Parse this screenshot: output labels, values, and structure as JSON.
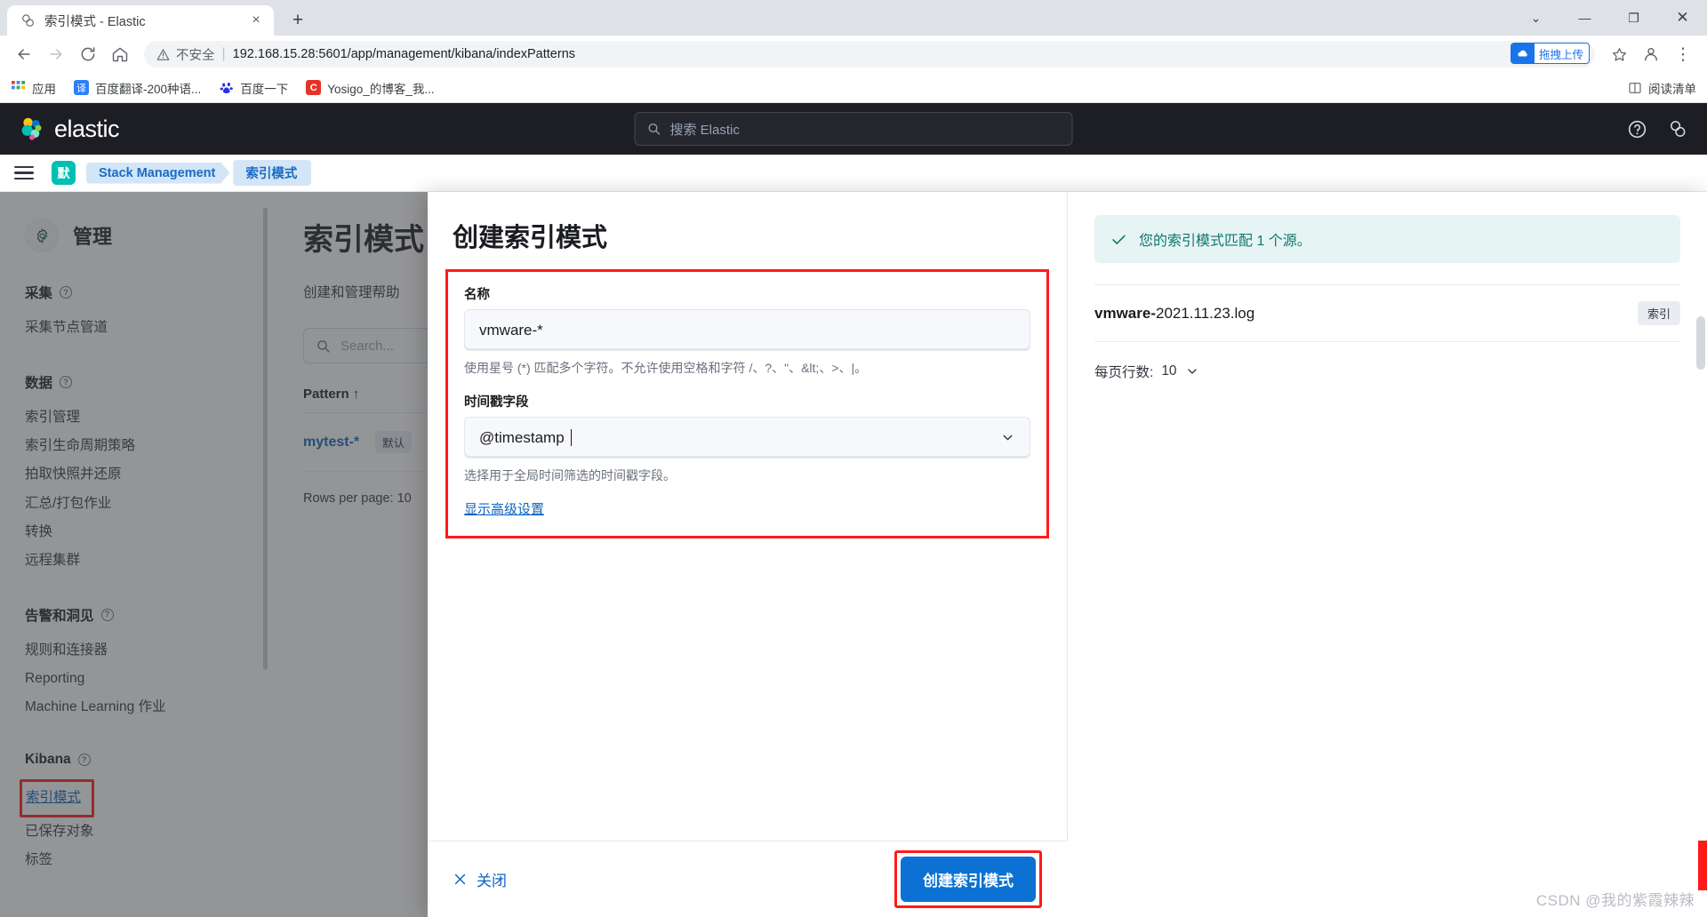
{
  "browser": {
    "tab": {
      "title": "索引模式 - Elastic",
      "favicon": "elastic-favicon",
      "close": "×"
    },
    "new_tab_label": "+",
    "window_controls": {
      "minimize_alt": "⌄",
      "minimize": "—",
      "maximize": "❐",
      "close": "✕"
    },
    "nav": {
      "back": "←",
      "forward": "→",
      "reload": "C",
      "home": "⌂"
    },
    "omnibox": {
      "security_label": "不安全",
      "separator": "|",
      "url": "192.168.15.28:5601/app/management/kibana/indexPatterns",
      "upload_chip": "拖拽上传",
      "star": "☆",
      "profile": "profile-icon",
      "menu": "⋮"
    },
    "bookmarks": [
      {
        "label": "应用",
        "icon": "apps-grid-icon",
        "color": "#ffffff"
      },
      {
        "label": "百度翻译-200种语...",
        "icon": "translate-icon",
        "color": "#2d7ff9"
      },
      {
        "label": "百度一下",
        "icon": "baidu-paw-icon",
        "color": "#ffffff"
      },
      {
        "label": "Yosigo_的博客_我...",
        "icon": "csdn-icon",
        "color": "#e63329"
      }
    ],
    "bookmarks_right": {
      "label": "阅读清单",
      "icon": "reading-list-icon"
    }
  },
  "elastic_header": {
    "brand": "elastic",
    "search_placeholder": "搜索 Elastic",
    "search_icon": "search-icon",
    "right_icons": [
      "help-icon",
      "news-icon"
    ]
  },
  "breadcrumb_bar": {
    "menu_icon": "hamburger-menu-icon",
    "space_badge": "默",
    "items": [
      {
        "label": "Stack Management"
      },
      {
        "label": "索引模式"
      }
    ]
  },
  "sidebar": {
    "title": "管理",
    "title_icon": "gear-icon",
    "groups": [
      {
        "heading": "采集",
        "has_help": true,
        "items": [
          {
            "label": "采集节点管道"
          }
        ]
      },
      {
        "heading": "数据",
        "has_help": true,
        "items": [
          {
            "label": "索引管理"
          },
          {
            "label": "索引生命周期策略"
          },
          {
            "label": "拍取快照并还原"
          },
          {
            "label": "汇总/打包作业"
          },
          {
            "label": "转换"
          },
          {
            "label": "远程集群"
          }
        ]
      },
      {
        "heading": "告警和洞见",
        "has_help": true,
        "items": [
          {
            "label": "规则和连接器"
          },
          {
            "label": "Reporting"
          },
          {
            "label": "Machine Learning 作业"
          }
        ]
      },
      {
        "heading": "Kibana",
        "has_help": true,
        "items": [
          {
            "label": "索引模式",
            "highlighted": true
          },
          {
            "label": "已保存对象"
          },
          {
            "label": "标签"
          }
        ]
      }
    ]
  },
  "main": {
    "title": "索引模式",
    "subtitle": "创建和管理帮助",
    "search_placeholder": "Search...",
    "search_icon": "search-icon",
    "table_header": "Pattern",
    "sort_icon": "↑",
    "rows": [
      {
        "name": "mytest-*",
        "badge": "默认"
      }
    ],
    "rows_per_page": "Rows per page: 10"
  },
  "flyout": {
    "heading": "创建索引模式",
    "name_field": {
      "label": "名称",
      "value": "vmware-*",
      "help": "使用星号 (*) 匹配多个字符。不允许使用空格和字符 /、?、\"、&lt;、>、|。"
    },
    "timestamp_field": {
      "label": "时间戳字段",
      "value": "@timestamp",
      "help": "选择用于全局时间筛选的时间戳字段。",
      "caret_icon": "chevron-down-icon"
    },
    "advanced_link": "显示高级设置",
    "footer": {
      "close_label": "关闭",
      "close_icon": "close-x-icon",
      "submit_label": "创建索引模式"
    },
    "right_panel": {
      "callout": "您的索引模式匹配 1 个源。",
      "callout_icon": "check-icon",
      "matches": [
        {
          "bold": "vmware-",
          "rest": "2021.11.23.log",
          "badge": "索引"
        }
      ],
      "rows_per_page_label": "每页行数:",
      "rows_per_page_value": "10",
      "rows_per_page_caret": "chevron-down-icon"
    }
  },
  "watermark": "CSDN @我的紫霞辣辣",
  "colors": {
    "accent_blue": "#0b64bd",
    "brand_teal": "#00bfb3",
    "highlight_red": "#ff1a1a",
    "callout_green": "#0f766d",
    "header_dark": "#1d1e24"
  }
}
